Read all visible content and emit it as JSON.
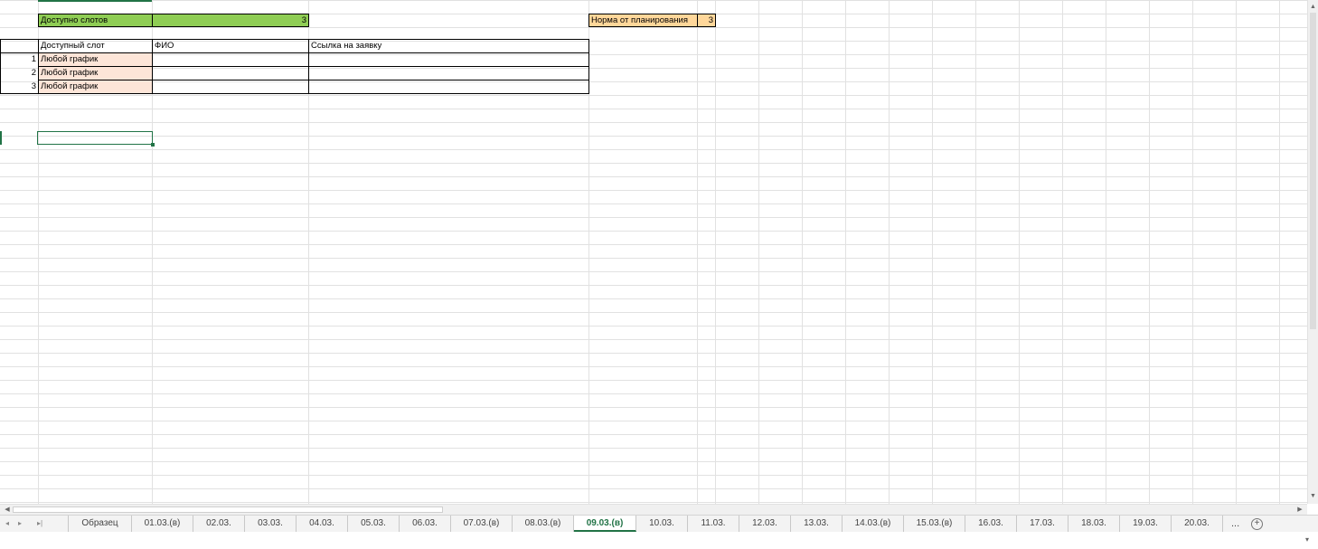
{
  "sheet": {
    "available_slots_label": "Доступно слотов",
    "available_slots_value": "3",
    "norm_label": "Норма от планирования",
    "norm_value": "3",
    "headers": [
      "Доступный слот",
      "ФИО",
      "Ссылка на заявку"
    ],
    "rows": [
      {
        "num": "1",
        "slot": "Любой график",
        "fio": "",
        "link": ""
      },
      {
        "num": "2",
        "slot": "Любой график",
        "fio": "",
        "link": ""
      },
      {
        "num": "3",
        "slot": "Любой график",
        "fio": "",
        "link": ""
      }
    ]
  },
  "tabs": [
    {
      "label": "Образец"
    },
    {
      "label": "01.03.(в)"
    },
    {
      "label": "02.03."
    },
    {
      "label": "03.03."
    },
    {
      "label": "04.03."
    },
    {
      "label": "05.03."
    },
    {
      "label": "06.03."
    },
    {
      "label": "07.03.(в)"
    },
    {
      "label": "08.03.(в)"
    },
    {
      "label": "09.03.(в)"
    },
    {
      "label": "10.03."
    },
    {
      "label": "11.03."
    },
    {
      "label": "12.03."
    },
    {
      "label": "13.03."
    },
    {
      "label": "14.03.(в)"
    },
    {
      "label": "15.03.(в)"
    },
    {
      "label": "16.03."
    },
    {
      "label": "17.03."
    },
    {
      "label": "18.03."
    },
    {
      "label": "19.03."
    },
    {
      "label": "20.03."
    }
  ],
  "active_tab": "09.03.(в)",
  "tab_more": "...",
  "add_sheet": "+",
  "colors": {
    "accent": "#217346",
    "green_fill": "#8fcd54",
    "orange_fill": "#ffd79a",
    "pink_fill": "#fde5d8"
  }
}
